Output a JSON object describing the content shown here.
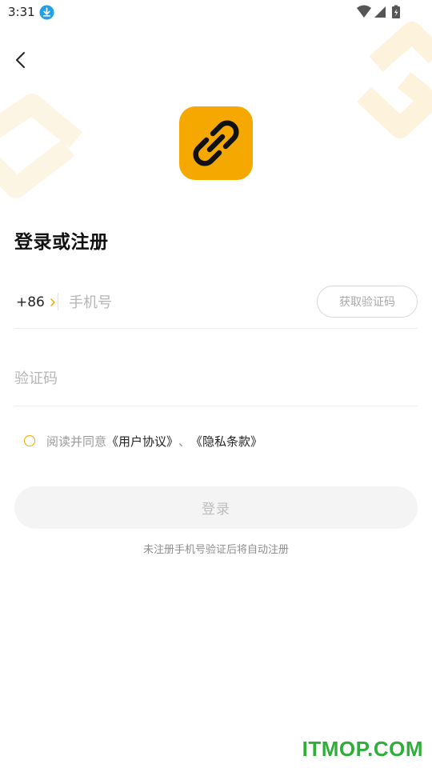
{
  "status_bar": {
    "time": "3:31",
    "icons": [
      "download-icon",
      "wifi-icon",
      "signal-icon",
      "battery-charging-icon"
    ]
  },
  "header": {
    "back_icon": "chevron-left-icon"
  },
  "logo": {
    "icon": "link-icon",
    "bg_color": "#f5a800"
  },
  "title": "登录或注册",
  "phone": {
    "country_code": "+86",
    "placeholder": "手机号",
    "value": "",
    "get_code_label": "获取验证码"
  },
  "code": {
    "placeholder": "验证码",
    "value": ""
  },
  "agreement": {
    "prefix": "阅读并同意",
    "user_agreement": "《用户协议》",
    "separator": "、",
    "privacy_policy": "《隐私条款》",
    "checked": false
  },
  "login_label": "登录",
  "hint": "未注册手机号验证后将自动注册",
  "watermark": "ITMOP.COM",
  "colors": {
    "accent": "#f5a800",
    "watermark": "#2fae3a"
  }
}
